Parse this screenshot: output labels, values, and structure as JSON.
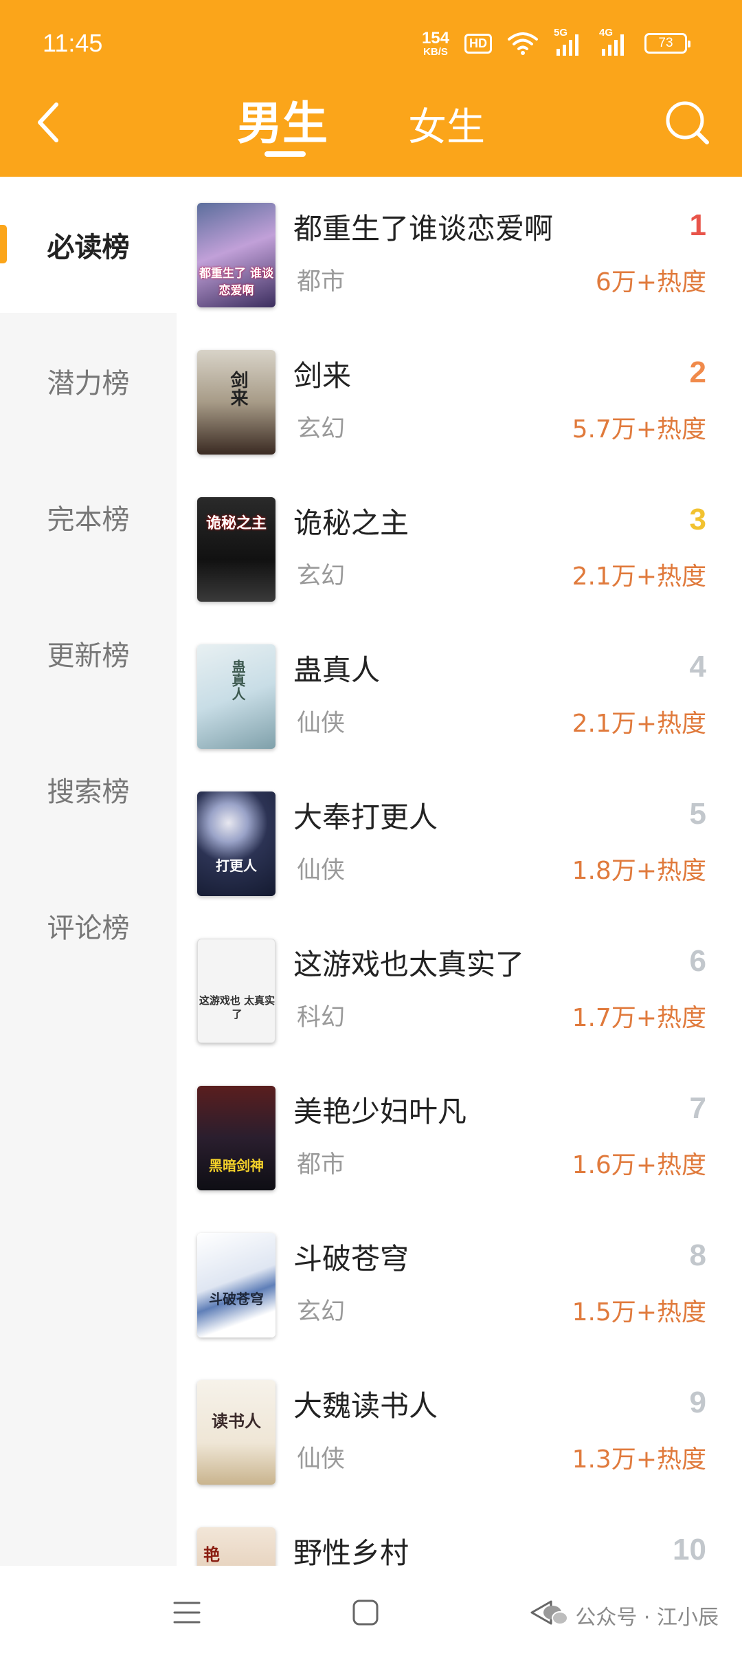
{
  "status": {
    "time": "11:45",
    "net_speed": "154",
    "net_unit": "KB/S",
    "hd": "HD",
    "sig1": "5G",
    "sig2": "4G",
    "battery": "73"
  },
  "header": {
    "tabs": [
      {
        "label": "男生",
        "active": true
      },
      {
        "label": "女生",
        "active": false
      }
    ]
  },
  "sidebar": {
    "items": [
      {
        "label": "必读榜",
        "active": true
      },
      {
        "label": "潜力榜"
      },
      {
        "label": "完本榜"
      },
      {
        "label": "更新榜"
      },
      {
        "label": "搜索榜"
      },
      {
        "label": "评论榜"
      }
    ]
  },
  "colors": {
    "accent": "#FBA51A",
    "rank1": "#E8544A",
    "rank2": "#F08A4B",
    "rank3": "#F2C230",
    "rank_other": "#C2C7CC",
    "heat": "#E07A3C"
  },
  "books": [
    {
      "rank": "1",
      "title": "都重生了谁谈恋爱啊",
      "category": "都市",
      "heat": "6万+热度"
    },
    {
      "rank": "2",
      "title": "剑来",
      "category": "玄幻",
      "heat": "5.7万+热度"
    },
    {
      "rank": "3",
      "title": "诡秘之主",
      "category": "玄幻",
      "heat": "2.1万+热度"
    },
    {
      "rank": "4",
      "title": "蛊真人",
      "category": "仙侠",
      "heat": "2.1万+热度"
    },
    {
      "rank": "5",
      "title": "大奉打更人",
      "category": "仙侠",
      "heat": "1.8万+热度"
    },
    {
      "rank": "6",
      "title": "这游戏也太真实了",
      "category": "科幻",
      "heat": "1.7万+热度"
    },
    {
      "rank": "7",
      "title": "美艳少妇叶凡",
      "category": "都市",
      "heat": "1.6万+热度"
    },
    {
      "rank": "8",
      "title": "斗破苍穹",
      "category": "玄幻",
      "heat": "1.5万+热度"
    },
    {
      "rank": "9",
      "title": "大魏读书人",
      "category": "仙侠",
      "heat": "1.3万+热度"
    },
    {
      "rank": "10",
      "title": "野性乡村",
      "category": "",
      "heat": ""
    }
  ],
  "covers": [
    {
      "text": "都重生了 谁谈恋爱啊"
    },
    {
      "text": "剑来"
    },
    {
      "text": "诡秘之主"
    },
    {
      "text": "蛊真人"
    },
    {
      "text": "打更人"
    },
    {
      "text": "这游戏也 太真实了"
    },
    {
      "text": "黑暗剑神"
    },
    {
      "text": "斗破苍穹"
    },
    {
      "text": "读书人"
    },
    {
      "text": "艳"
    }
  ],
  "watermark": {
    "text": "公众号 · 江小辰"
  }
}
